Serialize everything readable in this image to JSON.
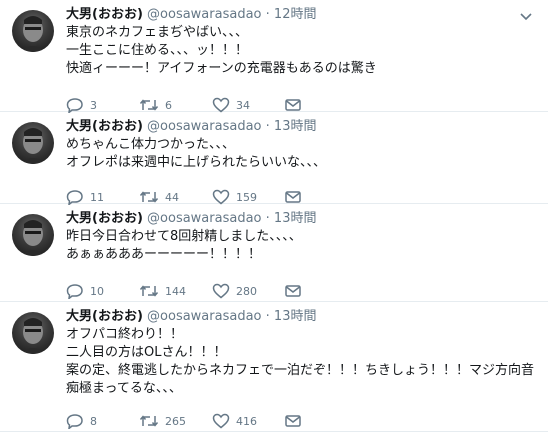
{
  "tweets": [
    {
      "name": "大男(おおお)",
      "handle": "@oosawarasadao",
      "separator": "·",
      "time": "12時間",
      "lines": [
        "東京のネカフェまぢやばい、、、",
        "一生ここに住める、、、ッ！！！",
        "快適ィーーー！アイフォーンの充電器もあるのは驚き"
      ],
      "replies": "3",
      "retweets": "6",
      "likes": "34"
    },
    {
      "name": "大男(おおお)",
      "handle": "@oosawarasadao",
      "separator": "·",
      "time": "13時間",
      "lines": [
        "めちゃんこ体力つかった、、、",
        "オフレポは来週中に上げられたらいいな、、、"
      ],
      "replies": "11",
      "retweets": "44",
      "likes": "159"
    },
    {
      "name": "大男(おおお)",
      "handle": "@oosawarasadao",
      "separator": "·",
      "time": "13時間",
      "lines": [
        "昨日今日合わせて8回射精しました、、、、",
        "あぁぁあああーーーーー！！！！"
      ],
      "replies": "10",
      "retweets": "144",
      "likes": "280"
    },
    {
      "name": "大男(おおお)",
      "handle": "@oosawarasadao",
      "separator": "·",
      "time": "13時間",
      "lines": [
        "オフパコ終わり！！",
        "二人目の方はOLさん！！！",
        "案の定、終電逃したからネカフェで一泊だぞ！！！ちきしょう！！！マジ方向音",
        "痴極まってるな、、、"
      ],
      "replies": "8",
      "retweets": "265",
      "likes": "416"
    }
  ],
  "icons": {
    "reply": "reply-icon",
    "retweet": "retweet-icon",
    "like": "heart-icon",
    "message": "envelope-icon",
    "more": "chevron-down-icon"
  },
  "colors": {
    "text": "#14171a",
    "secondary": "#657786",
    "divider": "#e6ecf0"
  }
}
